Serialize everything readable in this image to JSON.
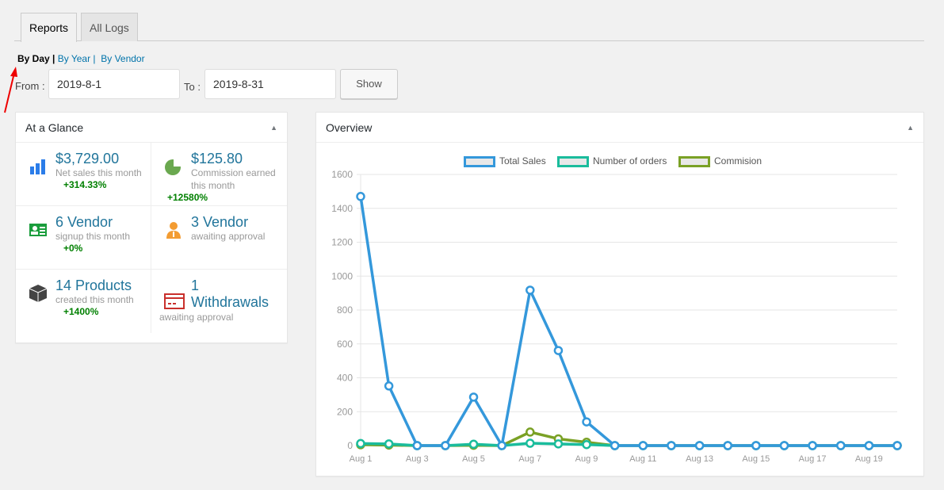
{
  "tabs": [
    {
      "label": "Reports",
      "active": true
    },
    {
      "label": "All Logs",
      "active": false
    }
  ],
  "subnav": {
    "current": "By Day",
    "sep": "|",
    "by_year": "By Year |",
    "by_vendor": "By Vendor"
  },
  "filters": {
    "from_label": "From :",
    "from_value": "2019-8-1",
    "to_label": "To :",
    "to_value": "2019-8-31",
    "show_label": "Show"
  },
  "glance": {
    "title": "At a Glance",
    "items": [
      {
        "icon": "bar-chart-icon",
        "value": "$3,729.00",
        "desc": "Net sales this month",
        "pct": "+314.33%"
      },
      {
        "icon": "pie-chart-icon",
        "value": "$125.80",
        "desc": "Commission earned this month",
        "pct": "+12580%"
      },
      {
        "icon": "id-card-icon",
        "value": "6 Vendor",
        "desc": "signup this month",
        "pct": "+0%"
      },
      {
        "icon": "user-icon",
        "value": "3 Vendor",
        "desc": "awaiting approval",
        "pct": ""
      },
      {
        "icon": "box-icon",
        "value": "14 Products",
        "desc": "created this month",
        "pct": "+1400%"
      },
      {
        "icon": "credit-card-icon",
        "value": "1 Withdrawals",
        "desc": "awaiting approval",
        "pct": ""
      }
    ]
  },
  "overview": {
    "title": "Overview"
  },
  "chart_data": {
    "type": "line",
    "title": "",
    "xlabel": "",
    "ylabel": "",
    "categories": [
      "Aug 1",
      "Aug 2",
      "Aug 3",
      "Aug 4",
      "Aug 5",
      "Aug 6",
      "Aug 7",
      "Aug 8",
      "Aug 9",
      "Aug 10",
      "Aug 11",
      "Aug 12",
      "Aug 13",
      "Aug 14",
      "Aug 15",
      "Aug 16",
      "Aug 17",
      "Aug 18",
      "Aug 19",
      "Aug 20"
    ],
    "xtick_labels": [
      "Aug 1",
      "Aug 3",
      "Aug 5",
      "Aug 7",
      "Aug 9",
      "Aug 11",
      "Aug 13",
      "Aug 15",
      "Aug 17",
      "Aug 19"
    ],
    "yticks": [
      0,
      200,
      400,
      600,
      800,
      1000,
      1200,
      1400,
      1600
    ],
    "ylim": [
      0,
      1600
    ],
    "grid": true,
    "legend": "top",
    "series": [
      {
        "name": "Commision",
        "color": "#7aa125",
        "values": [
          5,
          3,
          0,
          0,
          2,
          0,
          80,
          40,
          20,
          0,
          0,
          0,
          0,
          0,
          0,
          0,
          0,
          0,
          0,
          0
        ]
      },
      {
        "name": "Number of orders",
        "color": "#1abc9c",
        "values": [
          12,
          10,
          0,
          0,
          8,
          0,
          14,
          10,
          6,
          0,
          0,
          0,
          0,
          0,
          0,
          0,
          0,
          0,
          0,
          0
        ]
      },
      {
        "name": "Total Sales",
        "color": "#3498db",
        "values": [
          1470,
          352,
          0,
          0,
          286,
          0,
          917,
          561,
          140,
          0,
          0,
          0,
          0,
          0,
          0,
          0,
          0,
          0,
          0,
          0
        ]
      }
    ]
  }
}
